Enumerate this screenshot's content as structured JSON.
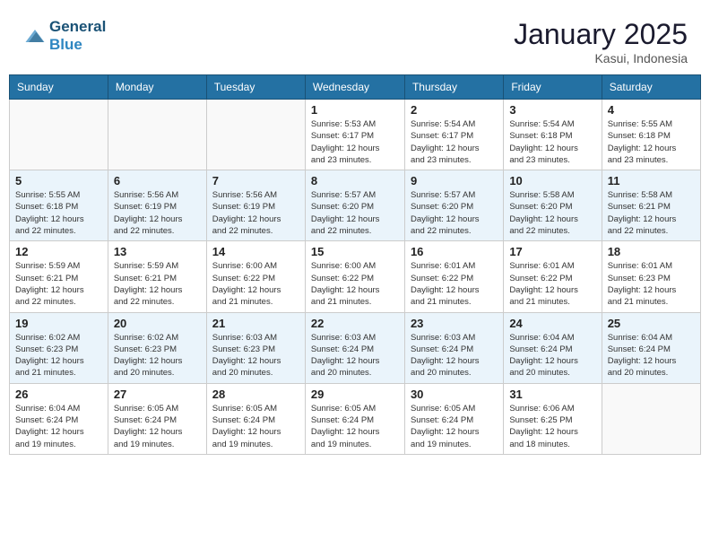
{
  "header": {
    "logo_line1": "General",
    "logo_line2": "Blue",
    "month": "January 2025",
    "location": "Kasui, Indonesia"
  },
  "days_of_week": [
    "Sunday",
    "Monday",
    "Tuesday",
    "Wednesday",
    "Thursday",
    "Friday",
    "Saturday"
  ],
  "weeks": [
    {
      "row_style": "normal",
      "days": [
        {
          "date": "",
          "info": ""
        },
        {
          "date": "",
          "info": ""
        },
        {
          "date": "",
          "info": ""
        },
        {
          "date": "1",
          "info": "Sunrise: 5:53 AM\nSunset: 6:17 PM\nDaylight: 12 hours\nand 23 minutes."
        },
        {
          "date": "2",
          "info": "Sunrise: 5:54 AM\nSunset: 6:17 PM\nDaylight: 12 hours\nand 23 minutes."
        },
        {
          "date": "3",
          "info": "Sunrise: 5:54 AM\nSunset: 6:18 PM\nDaylight: 12 hours\nand 23 minutes."
        },
        {
          "date": "4",
          "info": "Sunrise: 5:55 AM\nSunset: 6:18 PM\nDaylight: 12 hours\nand 23 minutes."
        }
      ]
    },
    {
      "row_style": "alt",
      "days": [
        {
          "date": "5",
          "info": "Sunrise: 5:55 AM\nSunset: 6:18 PM\nDaylight: 12 hours\nand 22 minutes."
        },
        {
          "date": "6",
          "info": "Sunrise: 5:56 AM\nSunset: 6:19 PM\nDaylight: 12 hours\nand 22 minutes."
        },
        {
          "date": "7",
          "info": "Sunrise: 5:56 AM\nSunset: 6:19 PM\nDaylight: 12 hours\nand 22 minutes."
        },
        {
          "date": "8",
          "info": "Sunrise: 5:57 AM\nSunset: 6:20 PM\nDaylight: 12 hours\nand 22 minutes."
        },
        {
          "date": "9",
          "info": "Sunrise: 5:57 AM\nSunset: 6:20 PM\nDaylight: 12 hours\nand 22 minutes."
        },
        {
          "date": "10",
          "info": "Sunrise: 5:58 AM\nSunset: 6:20 PM\nDaylight: 12 hours\nand 22 minutes."
        },
        {
          "date": "11",
          "info": "Sunrise: 5:58 AM\nSunset: 6:21 PM\nDaylight: 12 hours\nand 22 minutes."
        }
      ]
    },
    {
      "row_style": "normal",
      "days": [
        {
          "date": "12",
          "info": "Sunrise: 5:59 AM\nSunset: 6:21 PM\nDaylight: 12 hours\nand 22 minutes."
        },
        {
          "date": "13",
          "info": "Sunrise: 5:59 AM\nSunset: 6:21 PM\nDaylight: 12 hours\nand 22 minutes."
        },
        {
          "date": "14",
          "info": "Sunrise: 6:00 AM\nSunset: 6:22 PM\nDaylight: 12 hours\nand 21 minutes."
        },
        {
          "date": "15",
          "info": "Sunrise: 6:00 AM\nSunset: 6:22 PM\nDaylight: 12 hours\nand 21 minutes."
        },
        {
          "date": "16",
          "info": "Sunrise: 6:01 AM\nSunset: 6:22 PM\nDaylight: 12 hours\nand 21 minutes."
        },
        {
          "date": "17",
          "info": "Sunrise: 6:01 AM\nSunset: 6:22 PM\nDaylight: 12 hours\nand 21 minutes."
        },
        {
          "date": "18",
          "info": "Sunrise: 6:01 AM\nSunset: 6:23 PM\nDaylight: 12 hours\nand 21 minutes."
        }
      ]
    },
    {
      "row_style": "alt",
      "days": [
        {
          "date": "19",
          "info": "Sunrise: 6:02 AM\nSunset: 6:23 PM\nDaylight: 12 hours\nand 21 minutes."
        },
        {
          "date": "20",
          "info": "Sunrise: 6:02 AM\nSunset: 6:23 PM\nDaylight: 12 hours\nand 20 minutes."
        },
        {
          "date": "21",
          "info": "Sunrise: 6:03 AM\nSunset: 6:23 PM\nDaylight: 12 hours\nand 20 minutes."
        },
        {
          "date": "22",
          "info": "Sunrise: 6:03 AM\nSunset: 6:24 PM\nDaylight: 12 hours\nand 20 minutes."
        },
        {
          "date": "23",
          "info": "Sunrise: 6:03 AM\nSunset: 6:24 PM\nDaylight: 12 hours\nand 20 minutes."
        },
        {
          "date": "24",
          "info": "Sunrise: 6:04 AM\nSunset: 6:24 PM\nDaylight: 12 hours\nand 20 minutes."
        },
        {
          "date": "25",
          "info": "Sunrise: 6:04 AM\nSunset: 6:24 PM\nDaylight: 12 hours\nand 20 minutes."
        }
      ]
    },
    {
      "row_style": "normal",
      "days": [
        {
          "date": "26",
          "info": "Sunrise: 6:04 AM\nSunset: 6:24 PM\nDaylight: 12 hours\nand 19 minutes."
        },
        {
          "date": "27",
          "info": "Sunrise: 6:05 AM\nSunset: 6:24 PM\nDaylight: 12 hours\nand 19 minutes."
        },
        {
          "date": "28",
          "info": "Sunrise: 6:05 AM\nSunset: 6:24 PM\nDaylight: 12 hours\nand 19 minutes."
        },
        {
          "date": "29",
          "info": "Sunrise: 6:05 AM\nSunset: 6:24 PM\nDaylight: 12 hours\nand 19 minutes."
        },
        {
          "date": "30",
          "info": "Sunrise: 6:05 AM\nSunset: 6:24 PM\nDaylight: 12 hours\nand 19 minutes."
        },
        {
          "date": "31",
          "info": "Sunrise: 6:06 AM\nSunset: 6:25 PM\nDaylight: 12 hours\nand 18 minutes."
        },
        {
          "date": "",
          "info": ""
        }
      ]
    }
  ]
}
